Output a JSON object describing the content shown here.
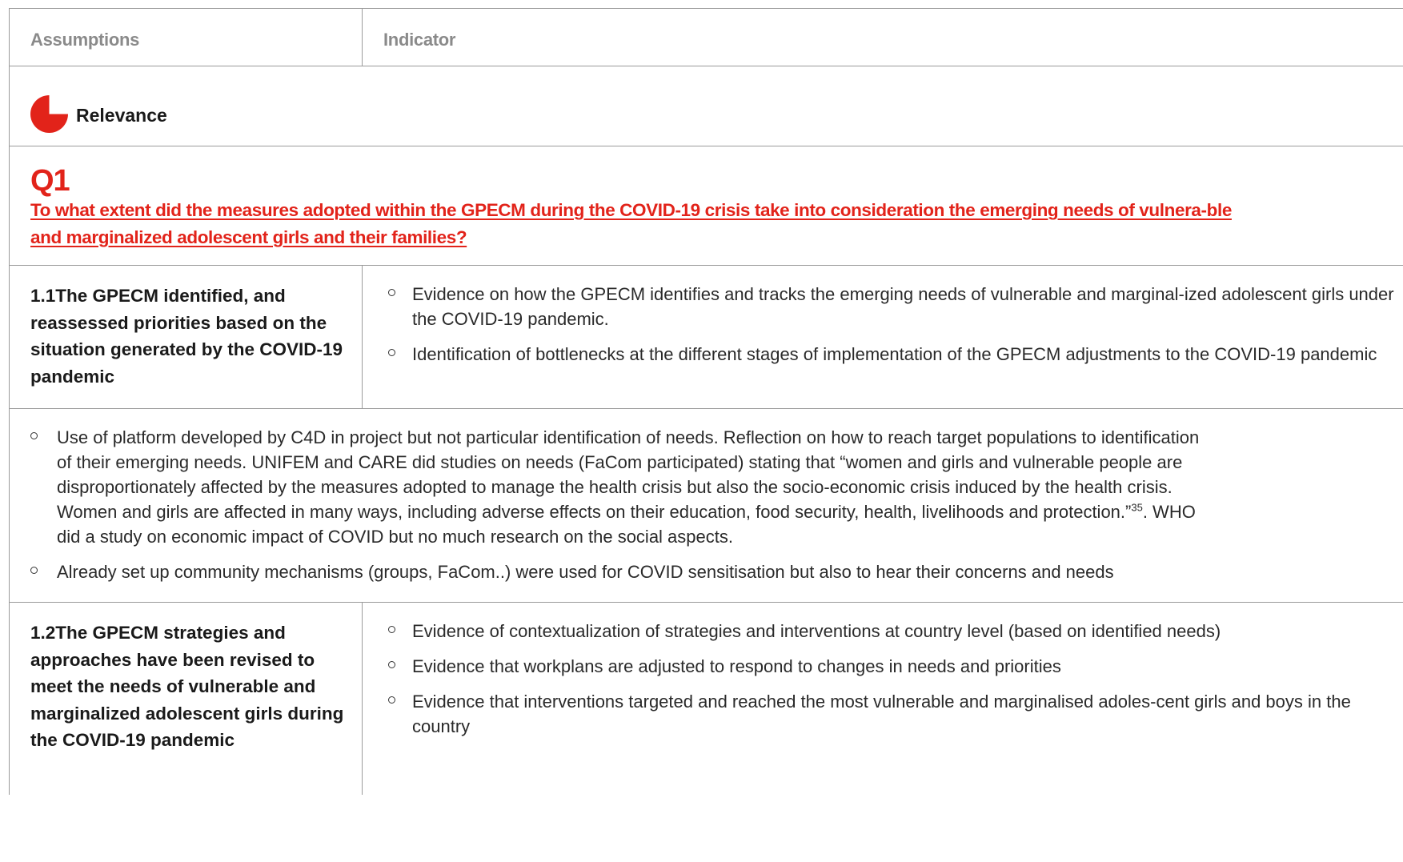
{
  "table_header": {
    "assumptions": "Assumptions",
    "indicator": "Indicator"
  },
  "section": {
    "icon": "quarter-pie-icon",
    "accent_color": "#e2231a",
    "label": "Relevance"
  },
  "question": {
    "number": "Q1",
    "text": "To what extent did the measures adopted within the GPECM during the COVID-19 crisis take into consideration the emerging needs of vulnera-ble and marginalized adolescent girls and their families?"
  },
  "assumption_1": {
    "number": "1.1",
    "title": "The GPECM identified, and reassessed priorities based on the situation generated by the COVID-19 pandemic",
    "indicators": [
      "Evidence on how the GPECM identifies and tracks the emerging needs of vulnerable and marginal-ized adolescent girls under the COVID-19 pandemic.",
      "Identification of bottlenecks at the different stages of implementation  of the GPECM adjustments to the COVID-19 pandemic"
    ]
  },
  "findings_1": {
    "item1_text": "Use of platform developed by C4D in project but not particular identification of needs. Reflection on how to reach target populations to identification of their emerging needs. UNIFEM and CARE did studies on needs (FaCom participated) stating that “women and girls and vulnerable people are disproportionately affected by the measures adopted to manage the health crisis but also the socio-economic crisis induced by the health crisis. Women and girls are affected in many ways, including adverse effects on their education, food security, health, livelihoods and protection.”",
    "item1_footnote": "35",
    "item1_after": ". WHO did a study on economic impact of COVID but no much research on the social aspects.",
    "item2_text": "Already set up community mechanisms (groups, FaCom..) were used for COVID sensitisation but also to hear their concerns and needs"
  },
  "assumption_2": {
    "number": "1.2",
    "title": "The GPECM strategies and approaches have been revised to meet the needs of vulnerable and marginalized adolescent girls during the COVID-19 pandemic",
    "indicators": [
      "Evidence of contextualization of strategies and interventions at country level (based on identified needs)",
      "Evidence that workplans are adjusted to respond to changes in needs and priorities",
      "Evidence that interventions targeted and reached the most vulnerable and marginalised adoles-cent girls and boys in the country"
    ]
  }
}
